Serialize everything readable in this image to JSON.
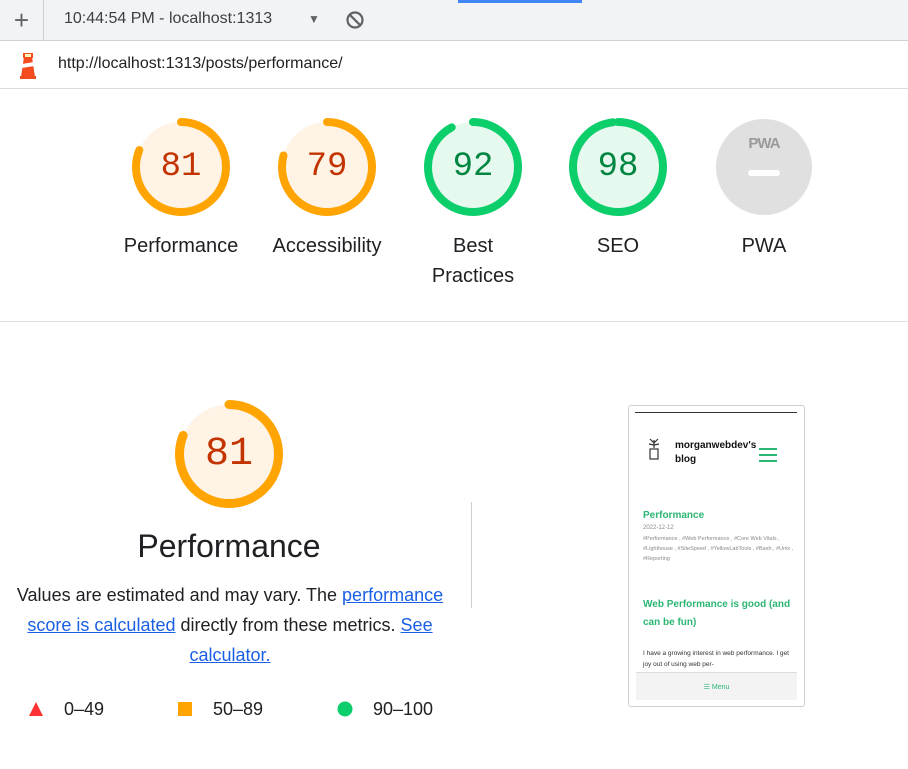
{
  "toolbar": {
    "new_tab_label": "+",
    "session_label": "10:44:54 PM - localhost:1313",
    "caret": "▼"
  },
  "urlbar": {
    "url": "http://localhost:1313/posts/performance/"
  },
  "gauges": [
    {
      "score": "81",
      "label": "Performance",
      "value": 0.81,
      "tier": "average"
    },
    {
      "score": "79",
      "label": "Accessibility",
      "value": 0.79,
      "tier": "average"
    },
    {
      "score": "92",
      "label": "Best Practices",
      "value": 0.92,
      "tier": "pass"
    },
    {
      "score": "98",
      "label": "SEO",
      "value": 0.98,
      "tier": "pass"
    },
    {
      "score": "PWA",
      "label": "PWA",
      "value": null,
      "tier": "na"
    }
  ],
  "detail": {
    "score": "81",
    "value": 0.81,
    "title": "Performance",
    "desc_prefix": "Values are estimated and may vary. The ",
    "desc_link1": "performance score is calculated",
    "desc_middle": " directly from these metrics. ",
    "desc_link2": "See calculator."
  },
  "legend": [
    {
      "range": "0–49",
      "shape": "triangle",
      "color": "#ff3333"
    },
    {
      "range": "50–89",
      "shape": "square",
      "color": "#ffa400"
    },
    {
      "range": "90–100",
      "shape": "circle",
      "color": "#0cce6b"
    }
  ],
  "thumbnail": {
    "blog_name": "morganwebdev's blog",
    "post_title": "Performance",
    "post_date": "2022-12-12",
    "tags": "#Performance , #Web Performance , #Core Web Vitals , #Lighthouse , #SiteSpeed , #YellowLabTools , #Bash , #Unix , #Reporting",
    "subhead": "Web Performance is good (and can be fun)",
    "paragraph": "I have a growing interest in web performance. I get joy out of using web per-",
    "menu_label": "☰ Menu"
  },
  "colors": {
    "average_fg": "#ffa400",
    "average_bg": "#fff3e6",
    "average_text": "#c33300",
    "pass_fg": "#0cce6b",
    "pass_bg": "#e6f9ee",
    "pass_text": "#018642",
    "na_bg": "#e0e0e0"
  }
}
